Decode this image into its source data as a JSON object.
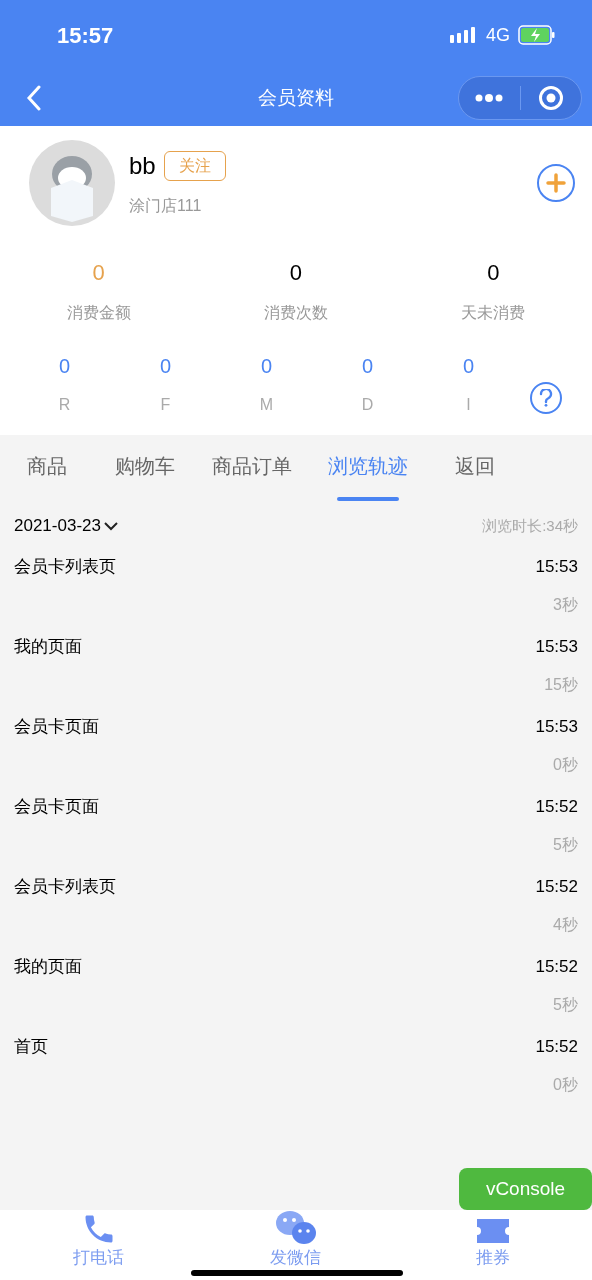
{
  "status_bar": {
    "time": "15:57",
    "network": "4G"
  },
  "nav": {
    "title": "会员资料"
  },
  "member": {
    "name": "bb",
    "tag": "关注",
    "store": "涂门店111"
  },
  "stats": [
    {
      "value": "0",
      "label": "消费金额",
      "kind": "highlight"
    },
    {
      "value": "0",
      "label": "消费次数",
      "kind": "plain"
    },
    {
      "value": "0",
      "label": "天未消费",
      "kind": "plain"
    }
  ],
  "rfm": [
    {
      "value": "0",
      "label": "R"
    },
    {
      "value": "0",
      "label": "F"
    },
    {
      "value": "0",
      "label": "M"
    },
    {
      "value": "0",
      "label": "D"
    },
    {
      "value": "0",
      "label": "I"
    }
  ],
  "tabs": [
    {
      "label": "商品",
      "selected": false
    },
    {
      "label": "购物车",
      "selected": false
    },
    {
      "label": "商品订单",
      "selected": false
    },
    {
      "label": "浏览轨迹",
      "selected": true
    },
    {
      "label": "返回",
      "selected": false
    }
  ],
  "date": "2021-03-23",
  "duration": "浏览时长:34秒",
  "visits": [
    {
      "page": "会员卡列表页",
      "time": "15:53",
      "stay": "3秒"
    },
    {
      "page": "我的页面",
      "time": "15:53",
      "stay": "15秒"
    },
    {
      "page": "会员卡页面",
      "time": "15:53",
      "stay": "0秒"
    },
    {
      "page": "会员卡页面",
      "time": "15:52",
      "stay": "5秒"
    },
    {
      "page": "会员卡列表页",
      "time": "15:52",
      "stay": "4秒"
    },
    {
      "page": "我的页面",
      "time": "15:52",
      "stay": "5秒"
    },
    {
      "page": "首页",
      "time": "15:52",
      "stay": "0秒"
    }
  ],
  "bottom_actions": [
    {
      "label": "打电话",
      "kind": "phone"
    },
    {
      "label": "发微信",
      "kind": "chat"
    },
    {
      "label": "推券",
      "kind": "coupon"
    }
  ],
  "vconsole": "vConsole"
}
